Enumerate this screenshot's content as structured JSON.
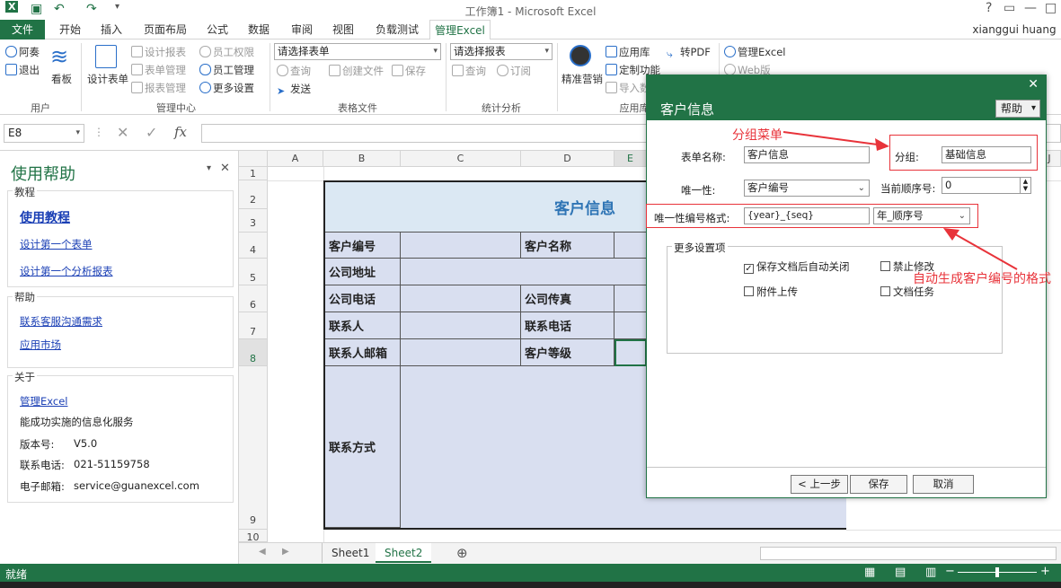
{
  "app": {
    "title": "工作簿1 - Microsoft Excel",
    "user": "xianggui huang"
  },
  "tabs": [
    "文件",
    "开始",
    "插入",
    "页面布局",
    "公式",
    "数据",
    "审阅",
    "视图",
    "负载测试",
    "管理Excel"
  ],
  "ribbon": {
    "user_group": {
      "items": [
        "阿奏",
        "退出"
      ],
      "board": "看板",
      "label": "用户"
    },
    "manage_center": {
      "design_form": "设计表单",
      "items": [
        "设计报表",
        "表单管理",
        "报表管理",
        "员工权限",
        "员工管理",
        "更多设置"
      ],
      "label": "管理中心"
    },
    "form_file": {
      "select_placeholder": "请选择表单",
      "items": [
        "查询",
        "创建文件",
        "保存",
        "发送"
      ],
      "label": "表格文件"
    },
    "stats": {
      "select_placeholder": "请选择报表",
      "items": [
        "查询",
        "订阅"
      ],
      "label": "统计分析"
    },
    "apps": {
      "precision": "精准营销",
      "items": [
        "应用库",
        "定制功能",
        "导入数"
      ],
      "pdf": "转PDF",
      "label": "应用库"
    },
    "excel_group": {
      "items": [
        "管理Excel",
        "Web版"
      ]
    }
  },
  "formula_bar": {
    "name_box": "E8",
    "fx": "fx"
  },
  "help_pane": {
    "title": "使用帮助",
    "tutorial_label": "教程",
    "tutorial_main": "使用教程",
    "tutorial_links": [
      "设计第一个表单",
      "设计第一个分析报表"
    ],
    "help_label": "帮助",
    "help_links": [
      "联系客服沟通需求",
      "应用市场"
    ],
    "about_label": "关于",
    "about_link": "管理Excel",
    "about_desc": "能成功实施的信息化服务",
    "version_label": "版本号:",
    "version": "V5.0",
    "phone_label": "联系电话:",
    "phone": "021-51159758",
    "email_label": "电子邮箱:",
    "email": "service@guanexcel.com"
  },
  "grid": {
    "columns": [
      "A",
      "B",
      "C",
      "D",
      "E"
    ],
    "rows": [
      "1",
      "2",
      "3",
      "4",
      "5",
      "6",
      "7",
      "8",
      "9",
      "10"
    ],
    "title": "客户信息",
    "labels": {
      "cust_no": "客户编号",
      "cust_name": "客户名称",
      "address": "公司地址",
      "phone": "公司电话",
      "fax": "公司传真",
      "contact": "联系人",
      "contact_phone": "联系电话",
      "email": "联系人邮箱",
      "level": "客户等级",
      "contact_method": "联系方式"
    },
    "extra_col": "J"
  },
  "sheets": [
    "Sheet1",
    "Sheet2"
  ],
  "status": {
    "ready": "就绪"
  },
  "dialog": {
    "title": "客户信息",
    "help": "帮助",
    "form_name_label": "表单名称:",
    "form_name": "客户信息",
    "group_label": "分组:",
    "group_value": "基础信息",
    "unique_label": "唯一性:",
    "unique_value": "客户编号",
    "seq_label": "当前顺序号:",
    "seq_value": "0",
    "format_label": "唯一性编号格式:",
    "format_value": "{year}_{seq}",
    "format_select": "年_顺序号",
    "more_label": "更多设置项",
    "checks": [
      {
        "label": "保存文档后自动关闭",
        "checked": true
      },
      {
        "label": "禁止修改",
        "checked": false
      },
      {
        "label": "附件上传",
        "checked": false
      },
      {
        "label": "文档任务",
        "checked": false
      }
    ],
    "buttons": {
      "prev": "< 上一步",
      "save": "保存",
      "cancel": "取消"
    }
  },
  "annotations": {
    "group_menu": "分组菜单",
    "auto_format": "自动生成客户编号的格式"
  },
  "colors": {
    "excel_green": "#217346",
    "annot_red": "#e8333a",
    "cell_fill": "#d9dff0"
  }
}
